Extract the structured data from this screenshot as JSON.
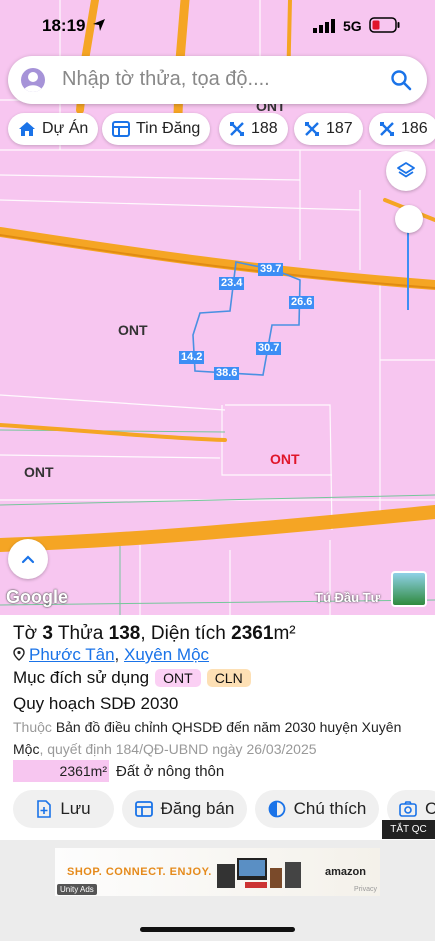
{
  "status_bar": {
    "time": "18:19",
    "network": "5G"
  },
  "search": {
    "placeholder": "Nhập tờ thửa, tọa độ...."
  },
  "chips": [
    {
      "label": "Dự Án",
      "icon": "home-icon"
    },
    {
      "label": "Tin Đăng",
      "icon": "list-icon"
    },
    {
      "label": "188",
      "icon": "map-marker-cross-icon"
    },
    {
      "label": "187",
      "icon": "map-marker-cross-icon"
    },
    {
      "label": "186",
      "icon": "map-marker-cross-icon"
    }
  ],
  "map": {
    "labels": {
      "top": "ONT",
      "left_mid": "ONT",
      "left_low": "ONT",
      "center": "ONT"
    },
    "dimensions": [
      "39.7",
      "23.4",
      "26.6",
      "30.7",
      "14.2",
      "38.6"
    ],
    "google": "Google",
    "credit": "Tú Đầu Tư"
  },
  "parcel": {
    "title_prefix": "Tờ ",
    "sheet": "3",
    "title_mid": " Thửa ",
    "lot": "138",
    "area_prefix": ", Diện tích ",
    "area": "2361",
    "area_unit": "m²",
    "ward": "Phước Tân",
    "separator": ", ",
    "district": "Xuyên Mộc",
    "purpose_label": "Mục đích sử dụng",
    "purposes": [
      "ONT",
      "CLN"
    ],
    "plan_title": "Quy hoạch SDĐ 2030",
    "belongs": "Thuộc ",
    "plan_map": "Bản đồ điều chỉnh QHSDĐ đến năm 2030 huyện Xuyên Mộc",
    "decision": ", quyết định 184/QĐ-UBND ngày 26/03/2025",
    "legend_area": "2361m²",
    "legend_label": "Đất ở nông thôn"
  },
  "actions": [
    "Lưu",
    "Đăng bán",
    "Chú thích",
    "C"
  ],
  "ad": {
    "close_label": "TẮT QC",
    "slogan": "SHOP. CONNECT. ENJOY.",
    "brand": "amazon",
    "provider": "Unity Ads",
    "privacy": "Privacy"
  },
  "colors": {
    "land_ont": "#f7c6f0",
    "road": "#f5a524",
    "accent": "#1a73e8"
  }
}
